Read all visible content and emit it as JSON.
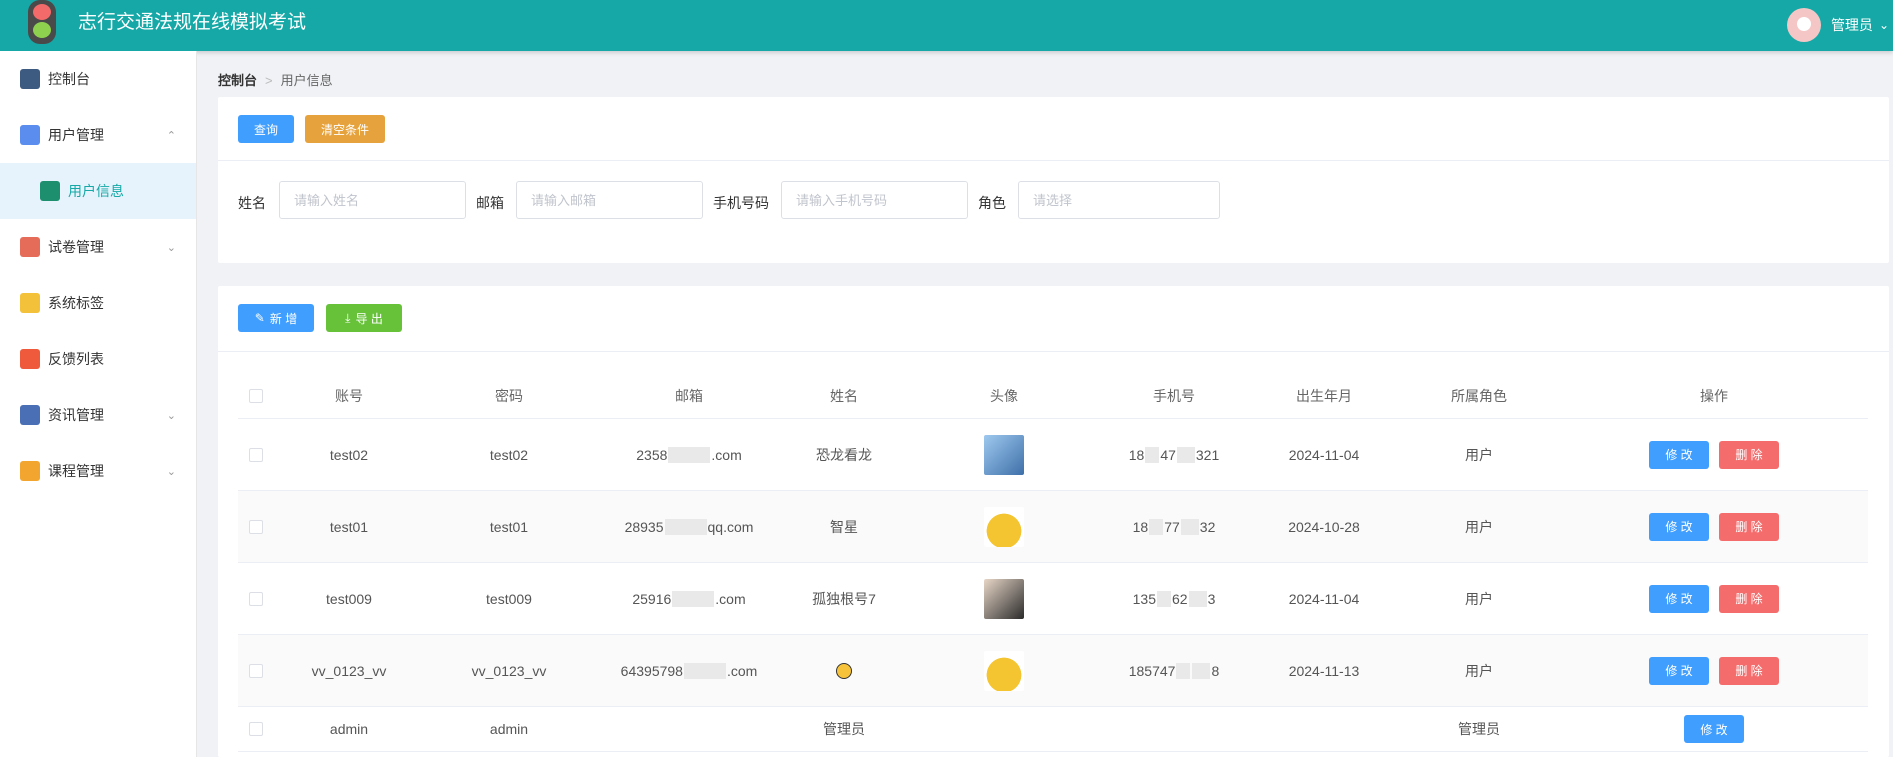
{
  "app": {
    "title": "志行交通法规在线模拟考试"
  },
  "user": {
    "name": "管理员"
  },
  "sidebar": {
    "items": [
      {
        "label": "控制台",
        "icon": "dashboard-icon",
        "color": "#3d5a80"
      },
      {
        "label": "用户管理",
        "icon": "user-manage-icon",
        "color": "#5b8def",
        "expanded": true
      },
      {
        "label": "用户信息",
        "icon": "user-info-icon",
        "color": "#1d8f6f",
        "sub": true
      },
      {
        "label": "试卷管理",
        "icon": "paper-icon",
        "color": "#e66c5a"
      },
      {
        "label": "系统标签",
        "icon": "tag-icon",
        "color": "#f3c13a"
      },
      {
        "label": "反馈列表",
        "icon": "feedback-icon",
        "color": "#f05a3c"
      },
      {
        "label": "资讯管理",
        "icon": "news-icon",
        "color": "#4a6fb5"
      },
      {
        "label": "课程管理",
        "icon": "course-icon",
        "color": "#f2a52f"
      }
    ]
  },
  "breadcrumb": {
    "root": "控制台",
    "current": "用户信息"
  },
  "toolbar": {
    "query": "查询",
    "clear": "清空条件",
    "add": "新 增",
    "export": "导 出"
  },
  "filters": {
    "name": {
      "label": "姓名",
      "placeholder": "请输入姓名"
    },
    "email": {
      "label": "邮箱",
      "placeholder": "请输入邮箱"
    },
    "phone": {
      "label": "手机号码",
      "placeholder": "请输入手机号码"
    },
    "role": {
      "label": "角色",
      "placeholder": "请选择"
    }
  },
  "table": {
    "headers": [
      "账号",
      "密码",
      "邮箱",
      "姓名",
      "头像",
      "手机号",
      "出生年月",
      "所属角色",
      "操作"
    ],
    "edit_label": "修 改",
    "delete_label": "删 除",
    "rows": [
      {
        "account": "test02",
        "password": "test02",
        "email_a": "2358",
        "email_b": ".com",
        "name": "恐龙看龙",
        "avatar": "photo-avatar",
        "phone_a": "18",
        "phone_b": "47",
        "phone_c": "321",
        "birth": "2024-11-04",
        "role": "用户"
      },
      {
        "account": "test01",
        "password": "test01",
        "email_a": "28935",
        "email_b": "qq.com",
        "name": "智星",
        "avatar": "cartoon-car-avatar",
        "phone_a": "18",
        "phone_b": "77",
        "phone_c": "32",
        "birth": "2024-10-28",
        "role": "用户"
      },
      {
        "account": "test009",
        "password": "test009",
        "email_a": "25916",
        "email_b": ".com",
        "name": "孤独根号7",
        "avatar": "portrait-avatar",
        "phone_a": "135",
        "phone_b": "62",
        "phone_c": "3",
        "birth": "2024-11-04",
        "role": "用户"
      },
      {
        "account": "vv_0123_vv",
        "password": "vv_0123_vv",
        "email_a": "64395798",
        "email_b": ".com",
        "name": "",
        "avatar": "cartoon-car-avatar",
        "phone_a": "185747",
        "phone_b": "",
        "phone_c": "8",
        "birth": "2024-11-13",
        "role": "用户"
      },
      {
        "account": "admin",
        "password": "admin",
        "email_a": "",
        "email_b": "",
        "name": "管理员",
        "avatar": "",
        "phone_a": "",
        "phone_b": "",
        "phone_c": "",
        "birth": "",
        "role": "管理员"
      }
    ]
  }
}
